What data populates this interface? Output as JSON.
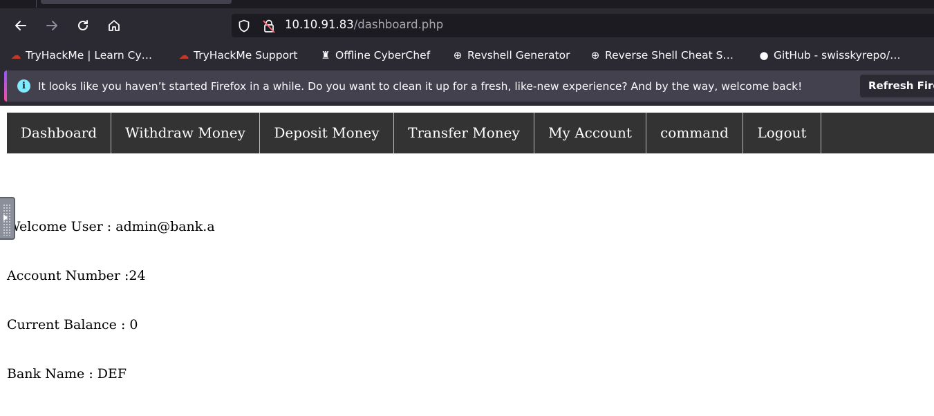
{
  "browser": {
    "url_host": "10.10.91.83",
    "url_path": "/dashboard.php",
    "nav_icons": [
      "back-arrow-icon",
      "forward-arrow-icon",
      "reload-icon",
      "home-icon"
    ],
    "bookmarks": [
      {
        "label": "TryHackMe | Learn Cy…",
        "icon": "tryhackme-cloud-icon"
      },
      {
        "label": "TryHackMe Support",
        "icon": "tryhackme-cloud-icon"
      },
      {
        "label": "Offline CyberChef",
        "icon": "chef-hat-icon"
      },
      {
        "label": "Revshell Generator",
        "icon": "globe-icon"
      },
      {
        "label": "Reverse Shell Cheat S…",
        "icon": "globe-icon"
      },
      {
        "label": "GitHub - swisskyrepo/…",
        "icon": "github-icon"
      }
    ],
    "notification": {
      "message": "It looks like you haven’t started Firefox in a while. Do you want to clean it up for a fresh, like-new experience? And by the way, welcome back!",
      "button": "Refresh Fire"
    }
  },
  "menu": {
    "items": [
      "Dashboard",
      "Withdraw Money",
      "Deposit Money",
      "Transfer Money",
      "My Account",
      "command",
      "Logout"
    ]
  },
  "account": {
    "welcome": "Welcome User : admin@bank.a",
    "account_number": "Account Number :24",
    "balance": "Current Balance : 0",
    "bank_name": "Bank Name : DEF"
  },
  "colors": {
    "chrome_bg": "#2b2a33",
    "urlbar_bg": "#1c1b22",
    "menu_bg": "#333333",
    "menu_text": "#ffffff",
    "info_icon": "#80ebff"
  }
}
